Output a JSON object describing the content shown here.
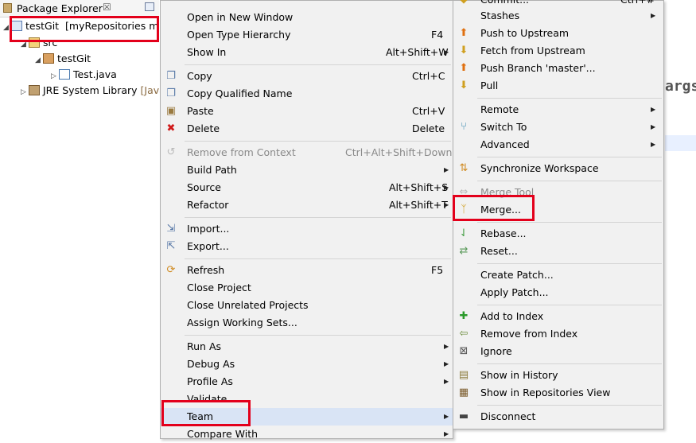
{
  "explorer": {
    "title": "Package Explorer",
    "close_glyph": "☒",
    "tree": {
      "project_name": "testGit",
      "project_repo": "[myRepositories m",
      "src": "src",
      "package": "testGit",
      "java_file": "Test.java",
      "library": "JRE System Library",
      "library_suffix": "[Java"
    }
  },
  "editor": {
    "fragment": "args"
  },
  "main_menu": {
    "open_new_window": "Open in New Window",
    "open_type_hierarchy": "Open Type Hierarchy",
    "open_type_hierarchy_sc": "F4",
    "show_in": "Show In",
    "show_in_sc": "Alt+Shift+W",
    "copy": "Copy",
    "copy_sc": "Ctrl+C",
    "copy_qualified": "Copy Qualified Name",
    "paste": "Paste",
    "paste_sc": "Ctrl+V",
    "delete": "Delete",
    "delete_sc": "Delete",
    "remove_context": "Remove from Context",
    "remove_context_sc": "Ctrl+Alt+Shift+Down",
    "build_path": "Build Path",
    "source": "Source",
    "source_sc": "Alt+Shift+S",
    "refactor": "Refactor",
    "refactor_sc": "Alt+Shift+T",
    "import": "Import...",
    "export": "Export...",
    "refresh": "Refresh",
    "refresh_sc": "F5",
    "close_project": "Close Project",
    "close_unrelated": "Close Unrelated Projects",
    "assign_sets": "Assign Working Sets...",
    "run_as": "Run As",
    "debug_as": "Debug As",
    "profile_as": "Profile As",
    "validate": "Validate",
    "team": "Team",
    "compare_with": "Compare With"
  },
  "team_menu": {
    "commit": "Commit...",
    "commit_sc": "Ctrl+#",
    "stashes": "Stashes",
    "push_upstream": "Push to Upstream",
    "fetch_upstream": "Fetch from Upstream",
    "push_branch": "Push Branch 'master'...",
    "pull": "Pull",
    "remote": "Remote",
    "switch_to": "Switch To",
    "advanced": "Advanced",
    "sync_workspace": "Synchronize Workspace",
    "merge_tool": "Merge Tool",
    "merge": "Merge...",
    "rebase": "Rebase...",
    "reset": "Reset...",
    "create_patch": "Create Patch...",
    "apply_patch": "Apply Patch...",
    "add_index": "Add to Index",
    "remove_index": "Remove from Index",
    "ignore": "Ignore",
    "show_history": "Show in History",
    "show_repos": "Show in Repositories View",
    "disconnect": "Disconnect"
  },
  "colors": {
    "highlight_box": "#e3001b",
    "menu_bg": "#f1f1f1"
  }
}
